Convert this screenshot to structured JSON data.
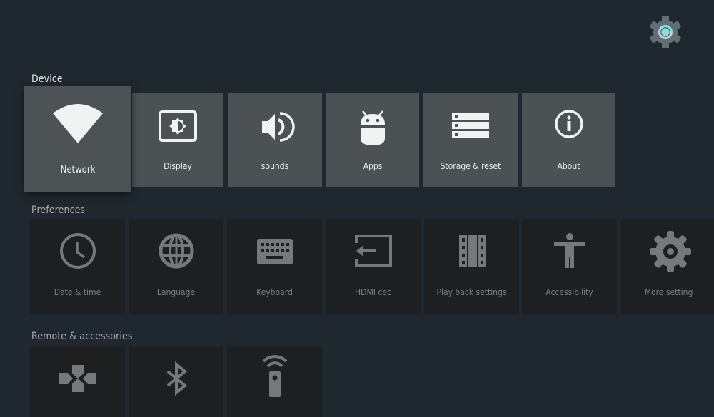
{
  "header": {
    "settings_icon": "gear-icon",
    "accent_color": "#7fe3e0"
  },
  "sections": {
    "device": {
      "title": "Device",
      "items": [
        {
          "label": "Network",
          "icon": "wifi-icon",
          "focused": true
        },
        {
          "label": "Display",
          "icon": "display-brightness-icon"
        },
        {
          "label": "sounds",
          "icon": "speaker-icon"
        },
        {
          "label": "Apps",
          "icon": "android-icon"
        },
        {
          "label": "Storage & reset",
          "icon": "storage-icon"
        },
        {
          "label": "About",
          "icon": "info-icon"
        }
      ]
    },
    "preferences": {
      "title": "Preferences",
      "items": [
        {
          "label": "Date & time",
          "icon": "clock-icon"
        },
        {
          "label": "Language",
          "icon": "globe-icon"
        },
        {
          "label": "Keyboard",
          "icon": "keyboard-icon"
        },
        {
          "label": "HDMI cec",
          "icon": "input-icon"
        },
        {
          "label": "Play back settings",
          "icon": "film-icon"
        },
        {
          "label": "Accessibility",
          "icon": "accessibility-icon"
        },
        {
          "label": "More setting",
          "icon": "gear-icon"
        }
      ]
    },
    "remote": {
      "title": "Remote & accessories",
      "items": [
        {
          "icon": "gamepad-icon"
        },
        {
          "icon": "bluetooth-icon"
        },
        {
          "icon": "remote-icon"
        }
      ]
    }
  }
}
